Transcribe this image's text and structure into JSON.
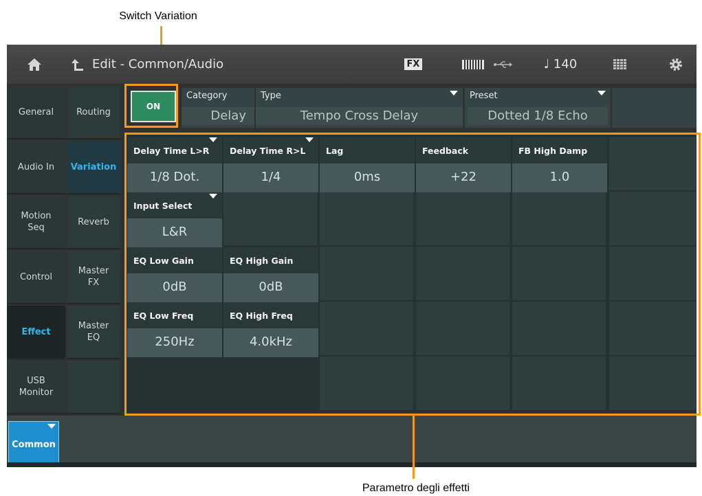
{
  "annotations": {
    "switch_variation": "Switch Variation",
    "effect_parameters": "Parametro degli effetti"
  },
  "topbar": {
    "title": "Edit - Common/Audio",
    "fx_label": "FX",
    "tempo": "♩ 140",
    "icons": [
      "home-icon",
      "back-arrow-icon",
      "keyboard-icon",
      "usb-icon",
      "grid-icon",
      "gear-icon"
    ]
  },
  "left_tabs": [
    {
      "label": "General",
      "selected": false
    },
    {
      "label": "Audio In",
      "selected": false
    },
    {
      "label": "Motion\nSeq",
      "selected": false
    },
    {
      "label": "Control",
      "selected": false
    },
    {
      "label": "Effect",
      "selected": true
    },
    {
      "label": "USB\nMonitor",
      "selected": false
    }
  ],
  "sub_tabs": [
    {
      "label": "Routing",
      "selected": false
    },
    {
      "label": "Variation",
      "selected": true
    },
    {
      "label": "Reverb",
      "selected": false
    },
    {
      "label": "Master\nFX",
      "selected": false
    },
    {
      "label": "Master\nEQ",
      "selected": false
    }
  ],
  "switch": {
    "label": "ON",
    "state": "on"
  },
  "category": {
    "label": "Category",
    "value": "Delay"
  },
  "type": {
    "label": "Type",
    "value": "Tempo Cross Delay"
  },
  "preset": {
    "label": "Preset",
    "value": "Dotted 1/8 Echo"
  },
  "params": {
    "delay_time_lr": {
      "label": "Delay Time L>R",
      "value": "1/8 Dot."
    },
    "delay_time_rl": {
      "label": "Delay Time R>L",
      "value": "1/4"
    },
    "lag": {
      "label": "Lag",
      "value": "0ms"
    },
    "feedback": {
      "label": "Feedback",
      "value": "+22"
    },
    "fb_high_damp": {
      "label": "FB High Damp",
      "value": "1.0"
    },
    "input_select": {
      "label": "Input Select",
      "value": "L&R"
    },
    "eq_low_gain": {
      "label": "EQ Low Gain",
      "value": "0dB"
    },
    "eq_high_gain": {
      "label": "EQ High Gain",
      "value": "0dB"
    },
    "eq_low_freq": {
      "label": "EQ Low Freq",
      "value": "250Hz"
    },
    "eq_high_freq": {
      "label": "EQ High Freq",
      "value": "4.0kHz"
    }
  },
  "bottom_tab": {
    "label": "Common"
  },
  "colors": {
    "accent_blue": "#35b4e8",
    "on_green": "#2e8a5f",
    "annotation_orange": "#f29a1f"
  }
}
